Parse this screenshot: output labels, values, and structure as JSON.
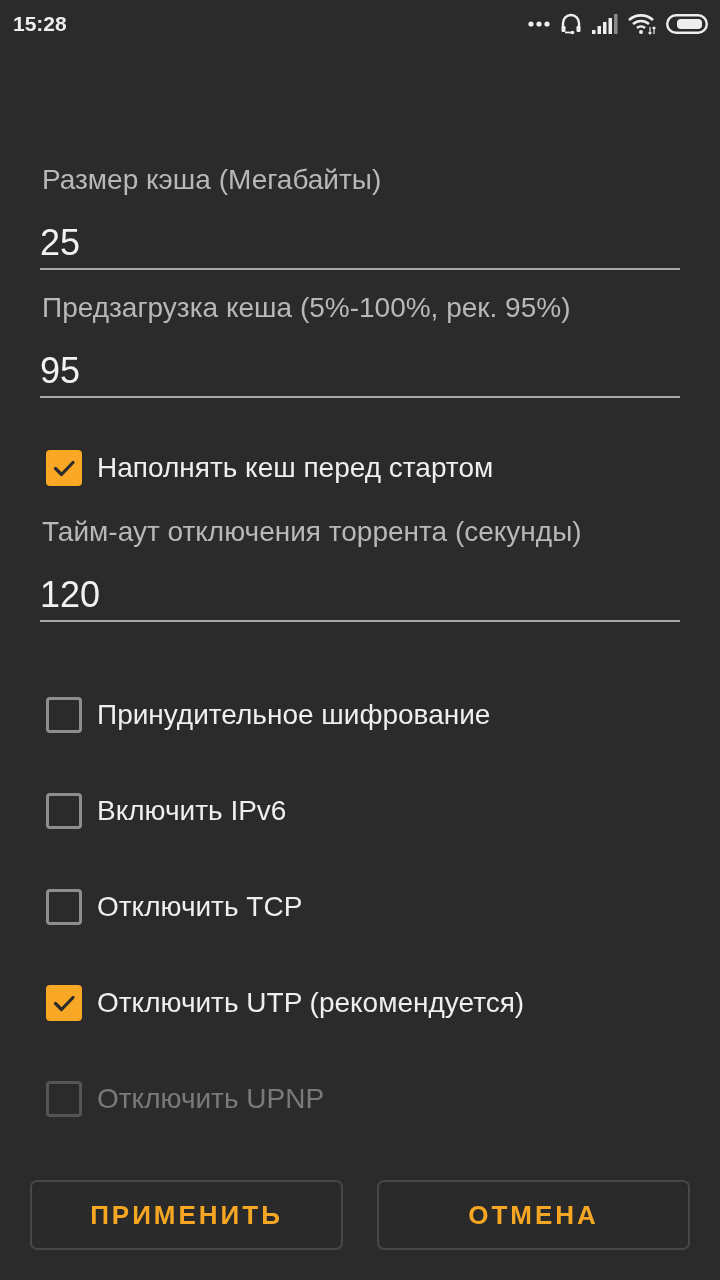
{
  "status_bar": {
    "time": "15:28"
  },
  "settings": [
    {
      "kind": "field",
      "label": "Размер кэша (Мегабайты)",
      "value": "25"
    },
    {
      "kind": "field",
      "label": "Предзагрузка кеша (5%-100%, рек. 95%)",
      "value": "95"
    },
    {
      "kind": "checkbox",
      "label": "Наполнять кеш перед стартом",
      "checked": true,
      "disabled": false
    },
    {
      "kind": "field",
      "label": "Тайм-аут отключения торрента (секунды)",
      "value": "120"
    },
    {
      "kind": "checkbox",
      "label": "Принудительное шифрование",
      "checked": false,
      "disabled": false
    },
    {
      "kind": "checkbox",
      "label": "Включить IPv6",
      "checked": false,
      "disabled": false
    },
    {
      "kind": "checkbox",
      "label": "Отключить TCP",
      "checked": false,
      "disabled": false
    },
    {
      "kind": "checkbox",
      "label": "Отключить UTP (рекомендуется)",
      "checked": true,
      "disabled": false
    },
    {
      "kind": "checkbox",
      "label": "Отключить UPNP",
      "checked": false,
      "disabled": true
    }
  ],
  "buttons": [
    "ПРИМЕНИТЬ",
    "ОТМЕНА"
  ]
}
